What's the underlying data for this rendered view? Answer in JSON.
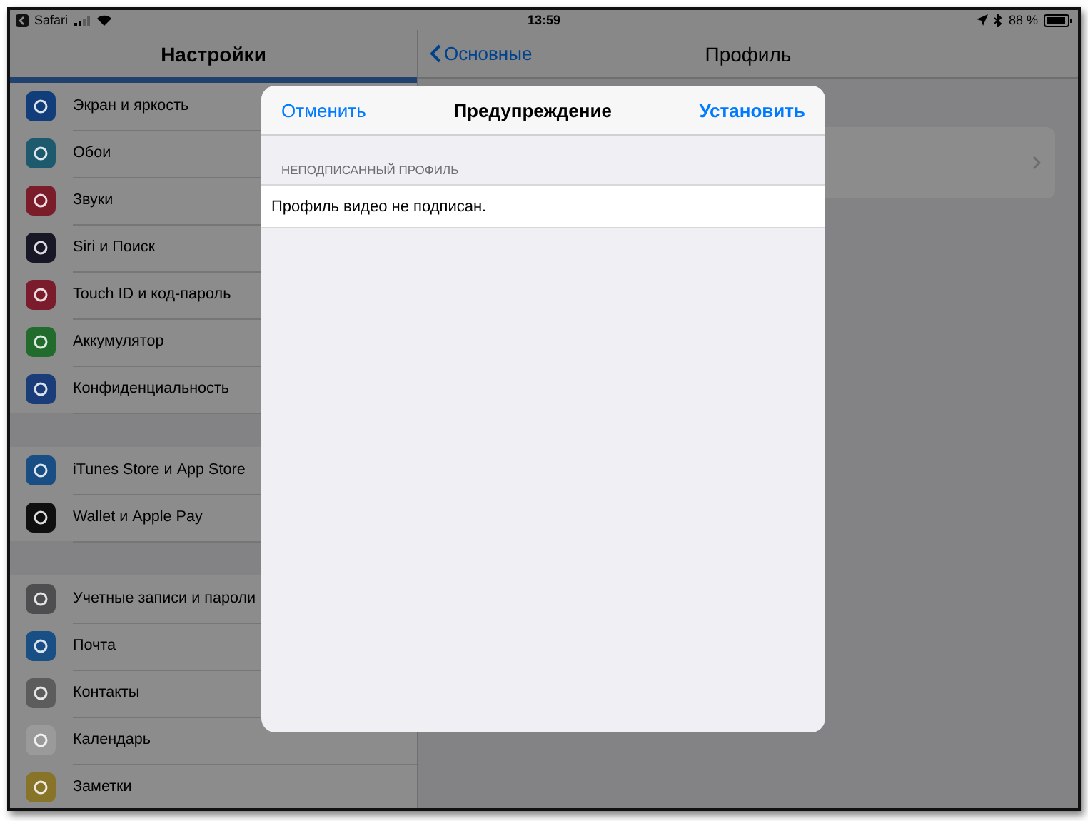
{
  "status_bar": {
    "back_app": "Safari",
    "time": "13:59",
    "battery": "88 %"
  },
  "sidebar": {
    "title": "Настройки",
    "groups": [
      [
        {
          "label": "Экран и яркость",
          "color": "#113d7b"
        },
        {
          "label": "Обои",
          "color": "#1d5a6e"
        },
        {
          "label": "Звуки",
          "color": "#7b1c2b"
        },
        {
          "label": "Siri и Поиск",
          "color": "#171726"
        },
        {
          "label": "Touch ID и код-пароль",
          "color": "#7b1c2c"
        },
        {
          "label": "Аккумулятор",
          "color": "#216b2c"
        },
        {
          "label": "Конфиденциальность",
          "color": "#1a3d7a"
        }
      ],
      [
        {
          "label": "iTunes Store и App Store",
          "color": "#184e84"
        },
        {
          "label": "Wallet и Apple Pay",
          "color": "#0f0f0f"
        }
      ],
      [
        {
          "label": "Учетные записи и пароли",
          "color": "#4e4e51"
        },
        {
          "label": "Почта",
          "color": "#184f84"
        },
        {
          "label": "Контакты",
          "color": "#5c5c5c"
        },
        {
          "label": "Календарь",
          "color": "#9a9a9a"
        },
        {
          "label": "Заметки",
          "color": "#877429"
        }
      ]
    ]
  },
  "detail": {
    "back": "Основные",
    "title": "Профиль"
  },
  "dialog": {
    "cancel": "Отменить",
    "title": "Предупреждение",
    "confirm": "Установить",
    "section_header": "НЕПОДПИСАННЫЙ ПРОФИЛЬ",
    "message": "Профиль видео не подписан."
  }
}
